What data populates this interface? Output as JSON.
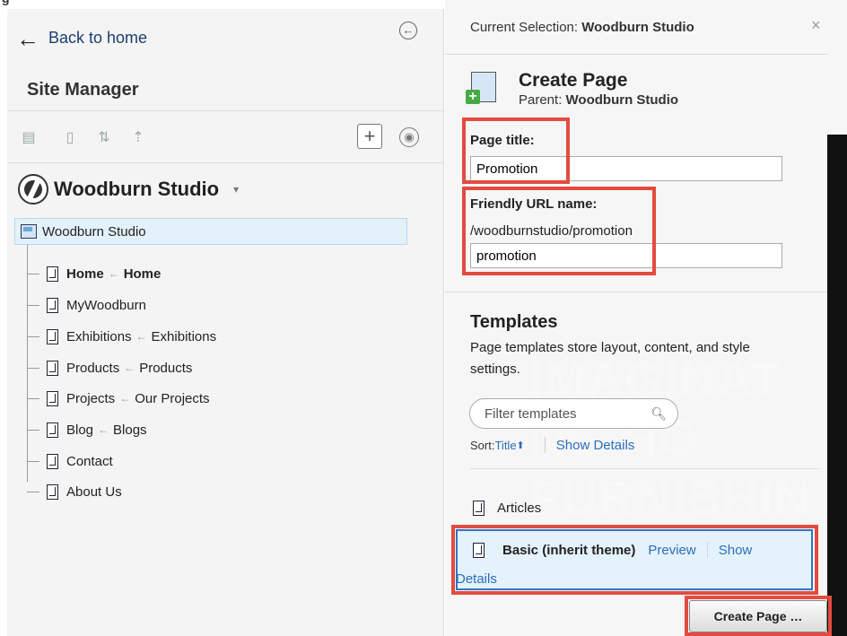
{
  "top_strip": {
    "text": "g"
  },
  "left_panel": {
    "back_link": "Back to home",
    "back_icon": "arrow-left-icon",
    "collapse_icon": "circle-arrow-left-icon",
    "title": "Site Manager",
    "toolbar_icons": [
      "site-map-icon",
      "page-icon",
      "move-up-down-icon",
      "move-up-icon"
    ],
    "add_icon": "plus-icon",
    "palette_icon": "palette-icon",
    "site_name": "Woodburn Studio",
    "site_icon": "globe-icon",
    "tree": {
      "root": "Woodburn Studio",
      "nodes": [
        {
          "name": "Home",
          "alias": "Home",
          "bold": true
        },
        {
          "name": "MyWoodburn",
          "alias": ""
        },
        {
          "name": "Exhibitions",
          "alias": "Exhibitions"
        },
        {
          "name": "Products",
          "alias": "Products"
        },
        {
          "name": "Projects",
          "alias": "Our Projects"
        },
        {
          "name": "Blog",
          "alias": "Blogs"
        },
        {
          "name": "Contact",
          "alias": ""
        },
        {
          "name": "About Us",
          "alias": ""
        }
      ]
    }
  },
  "right_panel": {
    "current_selection_label": "Current Selection: ",
    "current_selection_value": "Woodburn Studio",
    "close_icon": "close-icon",
    "create_page": {
      "title": "Create Page",
      "parent_label": "Parent: ",
      "parent_value": "Woodburn Studio"
    },
    "form": {
      "page_title_label": "Page title:",
      "page_title_value": "Promotion",
      "friendly_url_label": "Friendly URL name:",
      "friendly_url_path": "/woodburnstudio/promotion",
      "friendly_url_value": "promotion"
    },
    "templates": {
      "heading": "Templates",
      "description": "Page templates store layout, content, and style settings.",
      "filter_placeholder": "Filter templates",
      "sort_label": "Sort: ",
      "sort_value": "Title",
      "show_details": "Show Details",
      "items": [
        {
          "name": "Articles"
        },
        {
          "name": "Basic (inherit theme)",
          "preview": "Preview",
          "show": "Show",
          "details": "Details"
        }
      ]
    },
    "create_button": "Create Page …",
    "background_text": [
      "IMAGINAT",
      "NG HO",
      "FURNISHIN"
    ]
  },
  "highlight_color": "#e44b3f",
  "accent_color": "#2a6ebb"
}
